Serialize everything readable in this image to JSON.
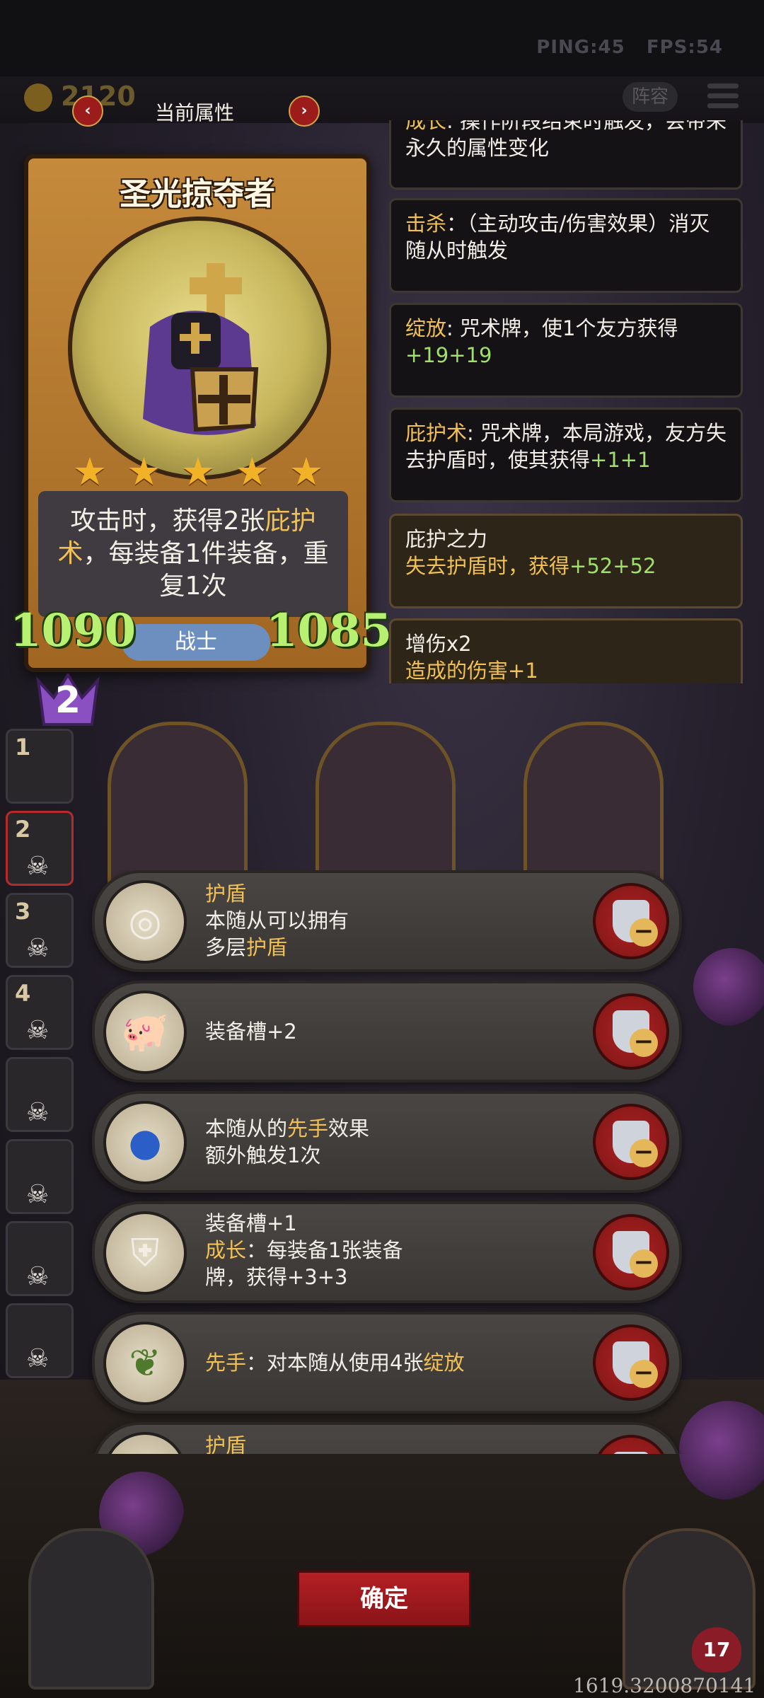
{
  "hud": {
    "ping": "PING:45",
    "fps": "FPS:54",
    "coins": "2120",
    "attr_title": "当前属性",
    "nav_prev": "‹",
    "nav_next": "›",
    "lineup_label": "阵容"
  },
  "hero": {
    "name": "圣光掠夺者",
    "stars": 5,
    "desc_parts": [
      "攻击时，获得2张",
      "庇护术",
      "，每装备1件装备，重复1次"
    ],
    "attack": "1090",
    "health": "1085",
    "class": "战士",
    "level": "2"
  },
  "tooltips": [
    {
      "key": "成长",
      "text": ": 操作阶段结束时触发，会带来永久的属性变化",
      "green": ""
    },
    {
      "key": "击杀",
      "text": "：（主动攻击/伤害效果）消灭随从时触发",
      "green": ""
    },
    {
      "key": "绽放",
      "text": ": 咒术牌，使1个友方获得",
      "green": "+19+19"
    },
    {
      "key": "庇护术",
      "text": ": 咒术牌，本局游戏，友方失去护盾时，使其获得",
      "green": "+1+1"
    },
    {
      "title": "庇护之力",
      "line": "失去护盾时，获得",
      "green": "+52+52"
    },
    {
      "title": "增伤x2",
      "line": "造成的伤害+1"
    }
  ],
  "sidebar_slots": [
    "1",
    "2",
    "3",
    "4",
    "",
    "",
    "",
    ""
  ],
  "equipment": [
    {
      "icon": "mirror-icon",
      "glyph": "◎",
      "title": "护盾",
      "line1": "本随从可以拥有",
      "line2_pre": "多层",
      "line2_key": "护盾"
    },
    {
      "icon": "pig-icon",
      "glyph": "🐖",
      "text": "装备槽+2"
    },
    {
      "icon": "orb-icon",
      "glyph": "●",
      "pre": "本随从的",
      "key": "先手",
      "post": "效果",
      "line2": "额外触发1次"
    },
    {
      "icon": "armor-icon",
      "glyph": "⛨",
      "line1": "装备槽+1",
      "key": "成长",
      "line2": "：每装备1张装备",
      "line3": "牌，获得+3+3"
    },
    {
      "icon": "vine-icon",
      "glyph": "❦",
      "key": "先手",
      "mid": "：对本随从使用4张",
      "key2": "绽放"
    },
    {
      "icon": "sun-icon",
      "glyph": "✹",
      "title": "护盾"
    }
  ],
  "bottom": {
    "confirm": "确定",
    "heart_value": "17",
    "coords": "1619.3200870141"
  },
  "colors": {
    "highlight": "#f1c155",
    "green": "#9fe06a",
    "confirm_red": "#b31f24",
    "stat_green": "#b8f071"
  }
}
